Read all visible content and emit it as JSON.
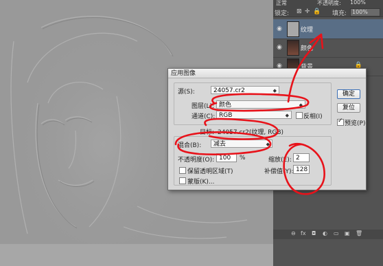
{
  "layers_panel": {
    "top_labels": {
      "blend_mode": "正常",
      "opacity_label": "不透明度:",
      "opacity_value": "100%"
    },
    "lock_label": "锁定:",
    "fill_label": "填充:",
    "fill_value": "100%",
    "layers": [
      {
        "name": "纹理",
        "active": true,
        "thumb_color": "#a8a8a8"
      },
      {
        "name": "颜色",
        "active": false,
        "thumb_color": "#7a4a3a"
      },
      {
        "name": "背景",
        "active": false,
        "thumb_color": "#6b4436",
        "locked": true
      }
    ],
    "bottom_icons": [
      "link-icon",
      "fx-icon",
      "mask-icon",
      "adjustment-icon",
      "group-icon",
      "new-layer-icon",
      "trash-icon"
    ],
    "bottom_glyphs": [
      "⊖",
      "fx",
      "◘",
      "◐",
      "▭",
      "▣",
      "🗑"
    ]
  },
  "dialog": {
    "title": "应用图像",
    "source_label": "源(S):",
    "source_value": "24057.cr2",
    "layer_label": "图层(L):",
    "layer_value": "颜色",
    "channel_label": "通道(C):",
    "channel_value": "RGB",
    "invert_label": "反相(I)",
    "target_label": "目标:",
    "target_value": "24057.cr2(纹理, RGB)",
    "blending_label": "混合(B):",
    "blending_value": "减去",
    "opacity_label": "不透明度(O):",
    "opacity_value": "100",
    "opacity_unit": "%",
    "scale_label": "缩放(E):",
    "scale_value": "2",
    "offset_label": "补偿值(Y):",
    "offset_value": "128",
    "preserve_label": "保留透明区域(T)",
    "mask_label": "蒙版(K)...",
    "ok_label": "确定",
    "reset_label": "复位",
    "preview_label": "预览(P)",
    "preview_checked": true
  },
  "annotation_color": "#e8121a"
}
